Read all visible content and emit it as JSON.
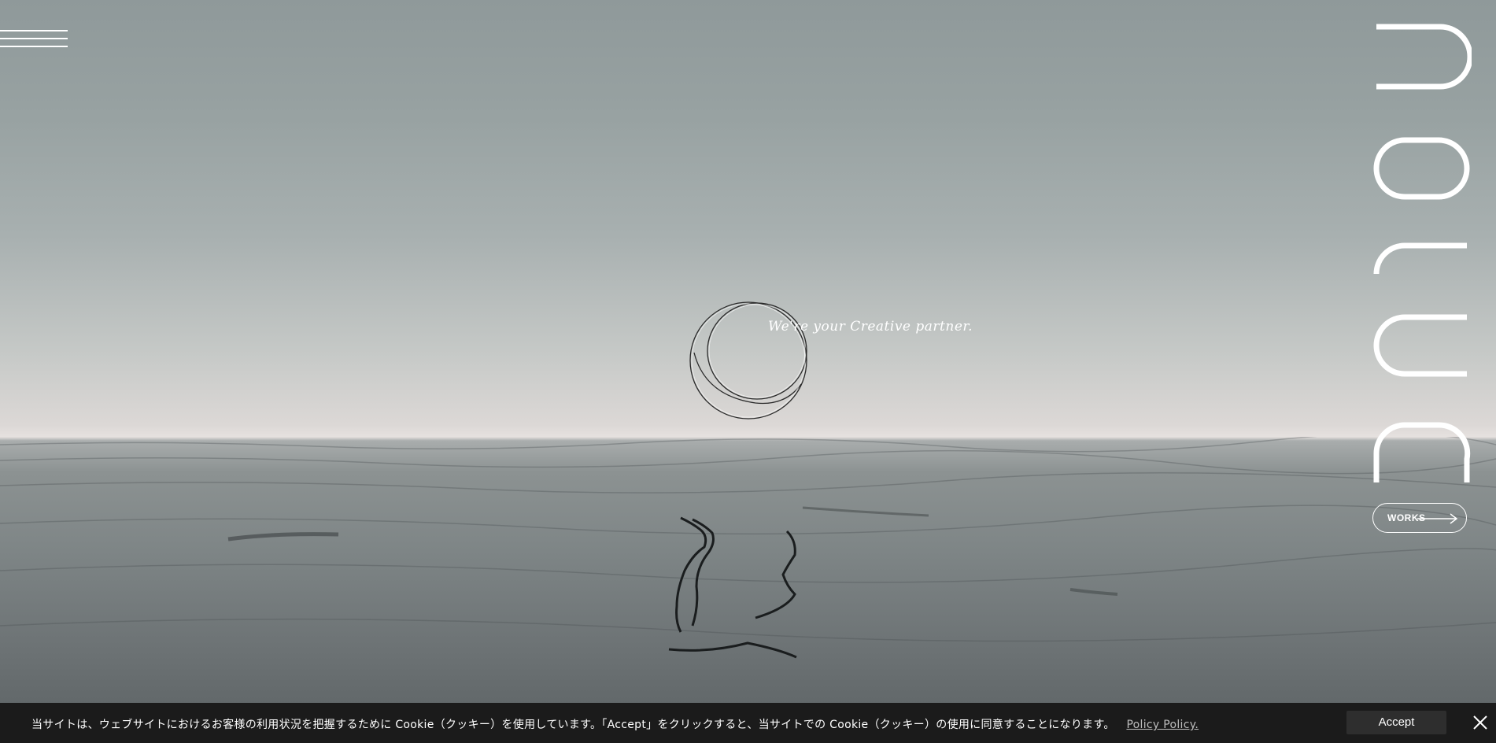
{
  "hero": {
    "tagline": "We're your  Creative partner."
  },
  "menu": {
    "icon": "hamburger-icon"
  },
  "brand": {
    "logo": "vertical-wordmark-logo"
  },
  "works": {
    "label": "WORKS",
    "icon": "arrow-right-icon"
  },
  "cookie_bar": {
    "message": "当サイトは、ウェブサイトにおけるお客様の利用状況を把握するために Cookie（クッキー）を使用しています。「Accept」をクリックすると、当サイトでの Cookie（クッキー）の使用に同意することになります。",
    "policy_link": "Policy Policy.",
    "accept_label": "Accept",
    "close_icon": "close-icon"
  }
}
